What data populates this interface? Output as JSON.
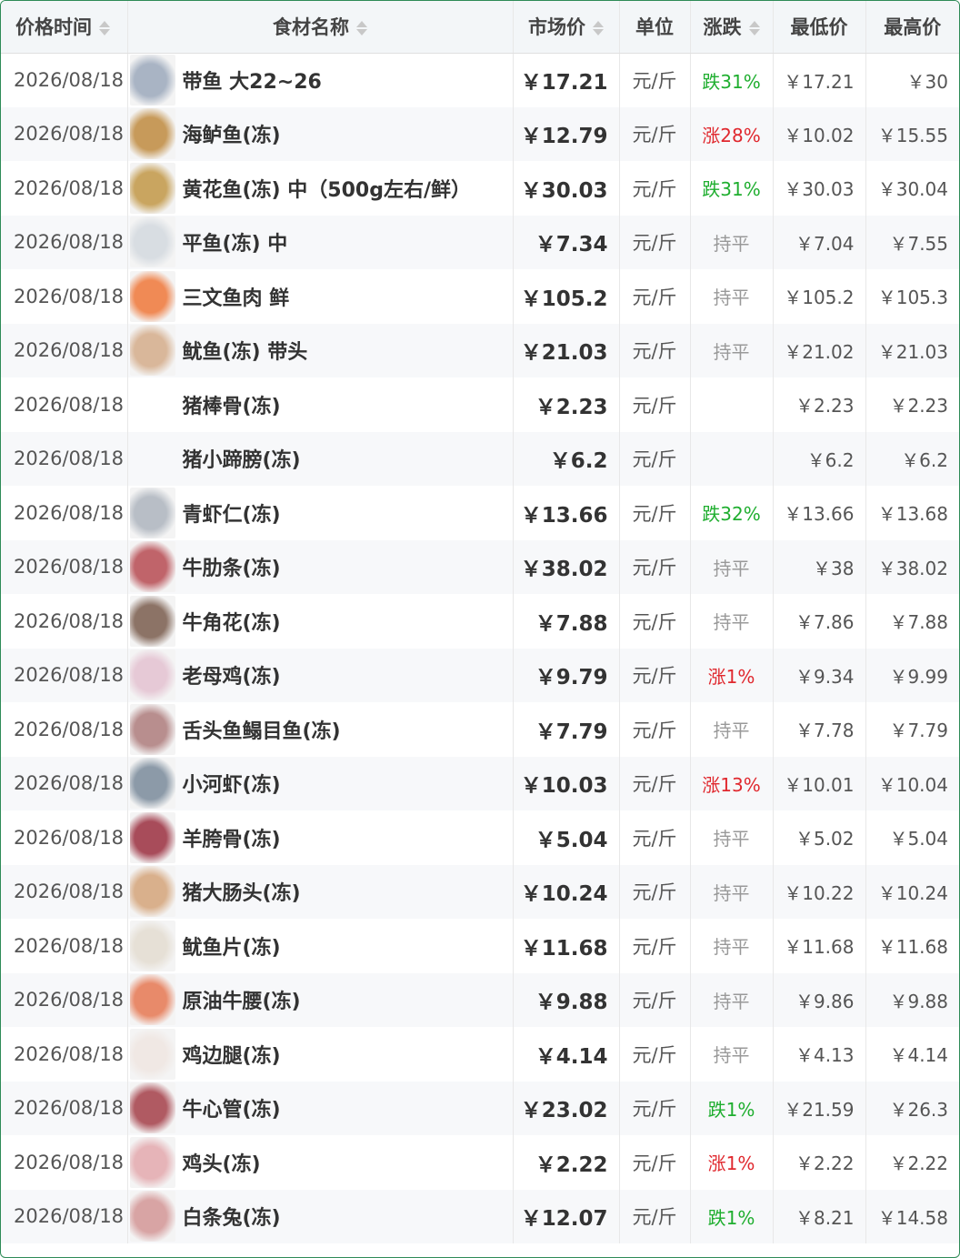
{
  "headers": {
    "time": "价格时间",
    "name": "食材名称",
    "market": "市场价",
    "unit": "单位",
    "change": "涨跌",
    "low": "最低价",
    "high": "最高价"
  },
  "colors": {
    "up": "#e0282e",
    "down": "#1fae2f",
    "flat": "#999999",
    "border": "#2e8b57"
  },
  "rows": [
    {
      "date": "2026/08/18",
      "name": "带鱼 大22~26",
      "price": "￥17.21",
      "unit": "元/斤",
      "change": "跌31%",
      "dir": "down",
      "low": "￥17.21",
      "high": "￥30",
      "thumb": "ribbonfish-image",
      "tc": "#a9b4c4"
    },
    {
      "date": "2026/08/18",
      "name": "海鲈鱼(冻)",
      "price": "￥12.79",
      "unit": "元/斤",
      "change": "涨28%",
      "dir": "up",
      "low": "￥10.02",
      "high": "￥15.55",
      "thumb": "seabass-image",
      "tc": "#c79a5a"
    },
    {
      "date": "2026/08/18",
      "name": "黄花鱼(冻) 中（500g左右/鲜）",
      "price": "￥30.03",
      "unit": "元/斤",
      "change": "跌31%",
      "dir": "down",
      "low": "￥30.03",
      "high": "￥30.04",
      "thumb": "croaker-image",
      "tc": "#c9a560"
    },
    {
      "date": "2026/08/18",
      "name": "平鱼(冻) 中",
      "price": "￥7.34",
      "unit": "元/斤",
      "change": "持平",
      "dir": "flat",
      "low": "￥7.04",
      "high": "￥7.55",
      "thumb": "pomfret-image",
      "tc": "#d8dde2"
    },
    {
      "date": "2026/08/18",
      "name": "三文鱼肉 鲜",
      "price": "￥105.2",
      "unit": "元/斤",
      "change": "持平",
      "dir": "flat",
      "low": "￥105.2",
      "high": "￥105.3",
      "thumb": "salmon-image",
      "tc": "#f08a55"
    },
    {
      "date": "2026/08/18",
      "name": "鱿鱼(冻) 带头",
      "price": "￥21.03",
      "unit": "元/斤",
      "change": "持平",
      "dir": "flat",
      "low": "￥21.02",
      "high": "￥21.03",
      "thumb": "squid-image",
      "tc": "#d9b79a"
    },
    {
      "date": "2026/08/18",
      "name": "猪棒骨(冻)",
      "price": "￥2.23",
      "unit": "元/斤",
      "change": "",
      "dir": "flat",
      "low": "￥2.23",
      "high": "￥2.23",
      "thumb": "",
      "tc": ""
    },
    {
      "date": "2026/08/18",
      "name": "猪小蹄膀(冻)",
      "price": "￥6.2",
      "unit": "元/斤",
      "change": "",
      "dir": "flat",
      "low": "￥6.2",
      "high": "￥6.2",
      "thumb": "",
      "tc": ""
    },
    {
      "date": "2026/08/18",
      "name": "青虾仁(冻)",
      "price": "￥13.66",
      "unit": "元/斤",
      "change": "跌32%",
      "dir": "down",
      "low": "￥13.66",
      "high": "￥13.68",
      "thumb": "shrimp-image",
      "tc": "#b8bec6"
    },
    {
      "date": "2026/08/18",
      "name": "牛肋条(冻)",
      "price": "￥38.02",
      "unit": "元/斤",
      "change": "持平",
      "dir": "flat",
      "low": "￥38",
      "high": "￥38.02",
      "thumb": "beef-rib-image",
      "tc": "#c0646a"
    },
    {
      "date": "2026/08/18",
      "name": "牛角花(冻)",
      "price": "￥7.88",
      "unit": "元/斤",
      "change": "持平",
      "dir": "flat",
      "low": "￥7.86",
      "high": "￥7.88",
      "thumb": "beef-tendon-image",
      "tc": "#8c7366"
    },
    {
      "date": "2026/08/18",
      "name": "老母鸡(冻)",
      "price": "￥9.79",
      "unit": "元/斤",
      "change": "涨1%",
      "dir": "up",
      "low": "￥9.34",
      "high": "￥9.99",
      "thumb": "hen-image",
      "tc": "#e6c9d6"
    },
    {
      "date": "2026/08/18",
      "name": "舌头鱼鳎目鱼(冻)",
      "price": "￥7.79",
      "unit": "元/斤",
      "change": "持平",
      "dir": "flat",
      "low": "￥7.78",
      "high": "￥7.79",
      "thumb": "sole-image",
      "tc": "#b88e8e"
    },
    {
      "date": "2026/08/18",
      "name": "小河虾(冻)",
      "price": "￥10.03",
      "unit": "元/斤",
      "change": "涨13%",
      "dir": "up",
      "low": "￥10.01",
      "high": "￥10.04",
      "thumb": "river-shrimp-image",
      "tc": "#8c9aa8"
    },
    {
      "date": "2026/08/18",
      "name": "羊胯骨(冻)",
      "price": "￥5.04",
      "unit": "元/斤",
      "change": "持平",
      "dir": "flat",
      "low": "￥5.02",
      "high": "￥5.04",
      "thumb": "lamb-bone-image",
      "tc": "#a84c5a"
    },
    {
      "date": "2026/08/18",
      "name": "猪大肠头(冻)",
      "price": "￥10.24",
      "unit": "元/斤",
      "change": "持平",
      "dir": "flat",
      "low": "￥10.22",
      "high": "￥10.24",
      "thumb": "pork-intestine-image",
      "tc": "#d9b08c"
    },
    {
      "date": "2026/08/18",
      "name": "鱿鱼片(冻)",
      "price": "￥11.68",
      "unit": "元/斤",
      "change": "持平",
      "dir": "flat",
      "low": "￥11.68",
      "high": "￥11.68",
      "thumb": "squid-slice-image",
      "tc": "#e6e0d6"
    },
    {
      "date": "2026/08/18",
      "name": "原油牛腰(冻)",
      "price": "￥9.88",
      "unit": "元/斤",
      "change": "持平",
      "dir": "flat",
      "low": "￥9.86",
      "high": "￥9.88",
      "thumb": "beef-kidney-image",
      "tc": "#e88a6a"
    },
    {
      "date": "2026/08/18",
      "name": "鸡边腿(冻)",
      "price": "￥4.14",
      "unit": "元/斤",
      "change": "持平",
      "dir": "flat",
      "low": "￥4.13",
      "high": "￥4.14",
      "thumb": "chicken-leg-image",
      "tc": "#f0e8e4"
    },
    {
      "date": "2026/08/18",
      "name": "牛心管(冻)",
      "price": "￥23.02",
      "unit": "元/斤",
      "change": "跌1%",
      "dir": "down",
      "low": "￥21.59",
      "high": "￥26.3",
      "thumb": "beef-heart-tube-image",
      "tc": "#b05a62"
    },
    {
      "date": "2026/08/18",
      "name": "鸡头(冻)",
      "price": "￥2.22",
      "unit": "元/斤",
      "change": "涨1%",
      "dir": "up",
      "low": "￥2.22",
      "high": "￥2.22",
      "thumb": "chicken-head-image",
      "tc": "#e6b4b8"
    },
    {
      "date": "2026/08/18",
      "name": "白条兔(冻)",
      "price": "￥12.07",
      "unit": "元/斤",
      "change": "跌1%",
      "dir": "down",
      "low": "￥8.21",
      "high": "￥14.58",
      "thumb": "rabbit-image",
      "tc": "#d8a4a4"
    }
  ]
}
